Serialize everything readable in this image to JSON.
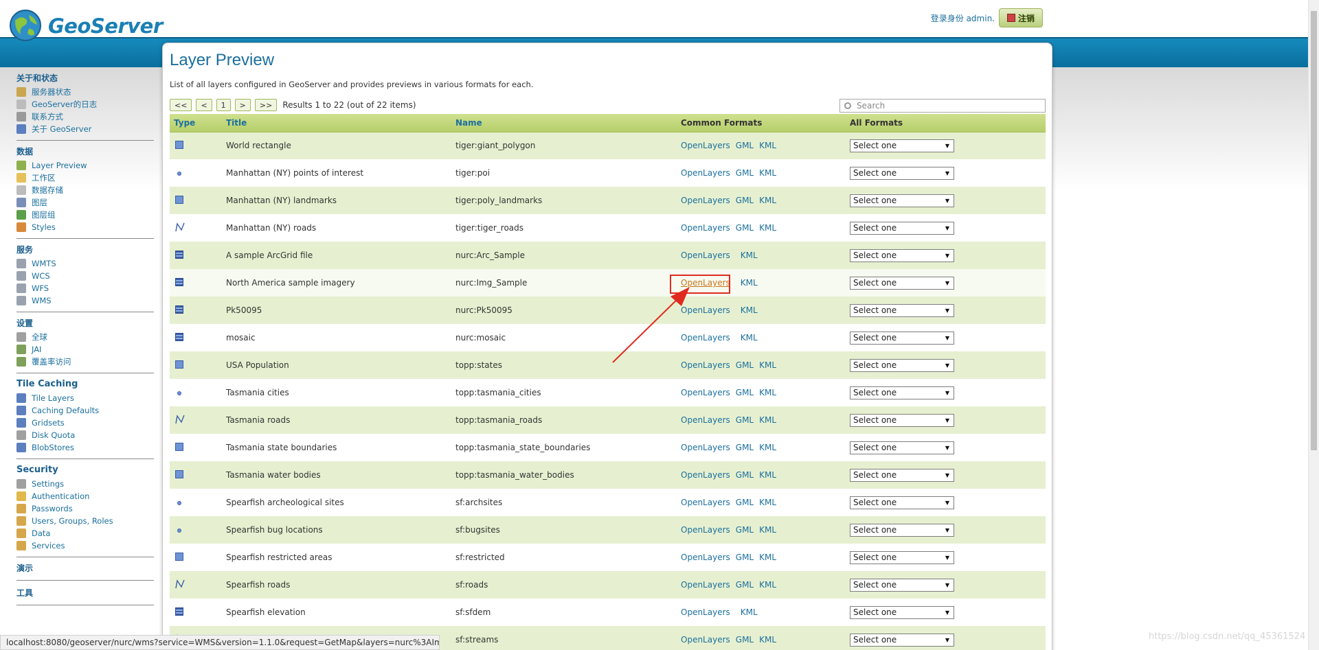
{
  "header": {
    "logo_text": "GeoServer",
    "login_status": "登录身份 admin.",
    "logout_label": "注销"
  },
  "sidebar": {
    "sections": [
      {
        "heading": "关于和状态",
        "items": [
          {
            "label": "服务器状态",
            "icon": "server-status-icon",
            "color": "#c9a64f"
          },
          {
            "label": "GeoServer的日志",
            "icon": "log-icon",
            "color": "#bcbcbc"
          },
          {
            "label": "联系方式",
            "icon": "contact-icon",
            "color": "#9a9a9a"
          },
          {
            "label": "关于 GeoServer",
            "icon": "about-icon",
            "color": "#5b7fbf"
          }
        ]
      },
      {
        "heading": "数据",
        "items": [
          {
            "label": "Layer Preview",
            "icon": "layer-preview-icon",
            "color": "#8fb04e"
          },
          {
            "label": "工作区",
            "icon": "workspace-icon",
            "color": "#e5c15a"
          },
          {
            "label": "数据存储",
            "icon": "store-icon",
            "color": "#bcbcbc"
          },
          {
            "label": "图层",
            "icon": "layer-icon",
            "color": "#7a8fb8"
          },
          {
            "label": "图层组",
            "icon": "layer-group-icon",
            "color": "#5b9f4a"
          },
          {
            "label": "Styles",
            "icon": "styles-icon",
            "color": "#d88a3b"
          }
        ]
      },
      {
        "heading": "服务",
        "items": [
          {
            "label": "WMTS",
            "icon": "wmts-icon",
            "color": "#9aa2b0"
          },
          {
            "label": "WCS",
            "icon": "wcs-icon",
            "color": "#9aa2b0"
          },
          {
            "label": "WFS",
            "icon": "wfs-icon",
            "color": "#9aa2b0"
          },
          {
            "label": "WMS",
            "icon": "wms-icon",
            "color": "#9aa2b0"
          }
        ]
      },
      {
        "heading": "设置",
        "items": [
          {
            "label": "全球",
            "icon": "global-icon",
            "color": "#a0a0a0"
          },
          {
            "label": "JAI",
            "icon": "jai-icon",
            "color": "#7fa05a"
          },
          {
            "label": "覆盖率访问",
            "icon": "coverage-icon",
            "color": "#7fa05a"
          }
        ]
      },
      {
        "heading": "Tile Caching",
        "items": [
          {
            "label": "Tile Layers",
            "icon": "tile-layers-icon",
            "color": "#5b7fbf"
          },
          {
            "label": "Caching Defaults",
            "icon": "caching-defaults-icon",
            "color": "#5b7fbf"
          },
          {
            "label": "Gridsets",
            "icon": "gridsets-icon",
            "color": "#5b7fbf"
          },
          {
            "label": "Disk Quota",
            "icon": "disk-quota-icon",
            "color": "#a0a0a0"
          },
          {
            "label": "BlobStores",
            "icon": "blobstores-icon",
            "color": "#5b7fbf"
          }
        ]
      },
      {
        "heading": "Security",
        "items": [
          {
            "label": "Settings",
            "icon": "settings-icon",
            "color": "#a0a0a0"
          },
          {
            "label": "Authentication",
            "icon": "authentication-icon",
            "color": "#e1b84a"
          },
          {
            "label": "Passwords",
            "icon": "passwords-icon",
            "color": "#d6a64a"
          },
          {
            "label": "Users, Groups, Roles",
            "icon": "users-icon",
            "color": "#d6a64a"
          },
          {
            "label": "Data",
            "icon": "data-icon",
            "color": "#d6a64a"
          },
          {
            "label": "Services",
            "icon": "services-icon",
            "color": "#d6a64a"
          }
        ]
      }
    ],
    "solo": [
      "演示",
      "工具"
    ]
  },
  "page": {
    "title": "Layer Preview",
    "description": "List of all layers configured in GeoServer and provides previews in various formats for each.",
    "pager": {
      "first": "<<",
      "prev": "<",
      "page": "1",
      "next": ">",
      "last": ">>",
      "results": "Results 1 to 22 (out of 22 items)"
    },
    "search_placeholder": "Search"
  },
  "table": {
    "headers": {
      "type": "Type",
      "title": "Title",
      "name": "Name",
      "common": "Common Formats",
      "all": "All Formats"
    },
    "select_label": "Select one",
    "rows": [
      {
        "type": "poly",
        "title": "World rectangle",
        "name": "tiger:giant_polygon",
        "formats": [
          "OpenLayers",
          "GML",
          "KML"
        ]
      },
      {
        "type": "point",
        "title": "Manhattan (NY) points of interest",
        "name": "tiger:poi",
        "formats": [
          "OpenLayers",
          "GML",
          "KML"
        ]
      },
      {
        "type": "poly",
        "title": "Manhattan (NY) landmarks",
        "name": "tiger:poly_landmarks",
        "formats": [
          "OpenLayers",
          "GML",
          "KML"
        ]
      },
      {
        "type": "line",
        "title": "Manhattan (NY) roads",
        "name": "tiger:tiger_roads",
        "formats": [
          "OpenLayers",
          "GML",
          "KML"
        ]
      },
      {
        "type": "raster",
        "title": "A sample ArcGrid file",
        "name": "nurc:Arc_Sample",
        "formats": [
          "OpenLayers",
          "KML"
        ]
      },
      {
        "type": "raster",
        "title": "North America sample imagery",
        "name": "nurc:Img_Sample",
        "formats": [
          "OpenLayers",
          "KML"
        ],
        "highlight": true
      },
      {
        "type": "raster",
        "title": "Pk50095",
        "name": "nurc:Pk50095",
        "formats": [
          "OpenLayers",
          "KML"
        ]
      },
      {
        "type": "raster",
        "title": "mosaic",
        "name": "nurc:mosaic",
        "formats": [
          "OpenLayers",
          "KML"
        ]
      },
      {
        "type": "poly",
        "title": "USA Population",
        "name": "topp:states",
        "formats": [
          "OpenLayers",
          "GML",
          "KML"
        ]
      },
      {
        "type": "point",
        "title": "Tasmania cities",
        "name": "topp:tasmania_cities",
        "formats": [
          "OpenLayers",
          "GML",
          "KML"
        ]
      },
      {
        "type": "line",
        "title": "Tasmania roads",
        "name": "topp:tasmania_roads",
        "formats": [
          "OpenLayers",
          "GML",
          "KML"
        ]
      },
      {
        "type": "poly",
        "title": "Tasmania state boundaries",
        "name": "topp:tasmania_state_boundaries",
        "formats": [
          "OpenLayers",
          "GML",
          "KML"
        ]
      },
      {
        "type": "poly",
        "title": "Tasmania water bodies",
        "name": "topp:tasmania_water_bodies",
        "formats": [
          "OpenLayers",
          "GML",
          "KML"
        ]
      },
      {
        "type": "point",
        "title": "Spearfish archeological sites",
        "name": "sf:archsites",
        "formats": [
          "OpenLayers",
          "GML",
          "KML"
        ]
      },
      {
        "type": "point",
        "title": "Spearfish bug locations",
        "name": "sf:bugsites",
        "formats": [
          "OpenLayers",
          "GML",
          "KML"
        ]
      },
      {
        "type": "poly",
        "title": "Spearfish restricted areas",
        "name": "sf:restricted",
        "formats": [
          "OpenLayers",
          "GML",
          "KML"
        ]
      },
      {
        "type": "line",
        "title": "Spearfish roads",
        "name": "sf:roads",
        "formats": [
          "OpenLayers",
          "GML",
          "KML"
        ]
      },
      {
        "type": "raster",
        "title": "Spearfish elevation",
        "name": "sf:sfdem",
        "formats": [
          "OpenLayers",
          "KML"
        ]
      },
      {
        "type": "line",
        "title": "",
        "name": "sf:streams",
        "formats": [
          "OpenLayers",
          "GML",
          "KML"
        ]
      }
    ]
  },
  "status_bar": {
    "url": "localhost:8080/geoserver/nurc/wms?service=WMS&version=1.1.0&request=GetMap&layers=nurc%3AImg..."
  },
  "watermark": "https://blog.csdn.net/qq_45361524",
  "colors": {
    "accent": "#1a6f9e",
    "highlight": "#e02a1f",
    "row_alt": "#e6f0d0"
  }
}
